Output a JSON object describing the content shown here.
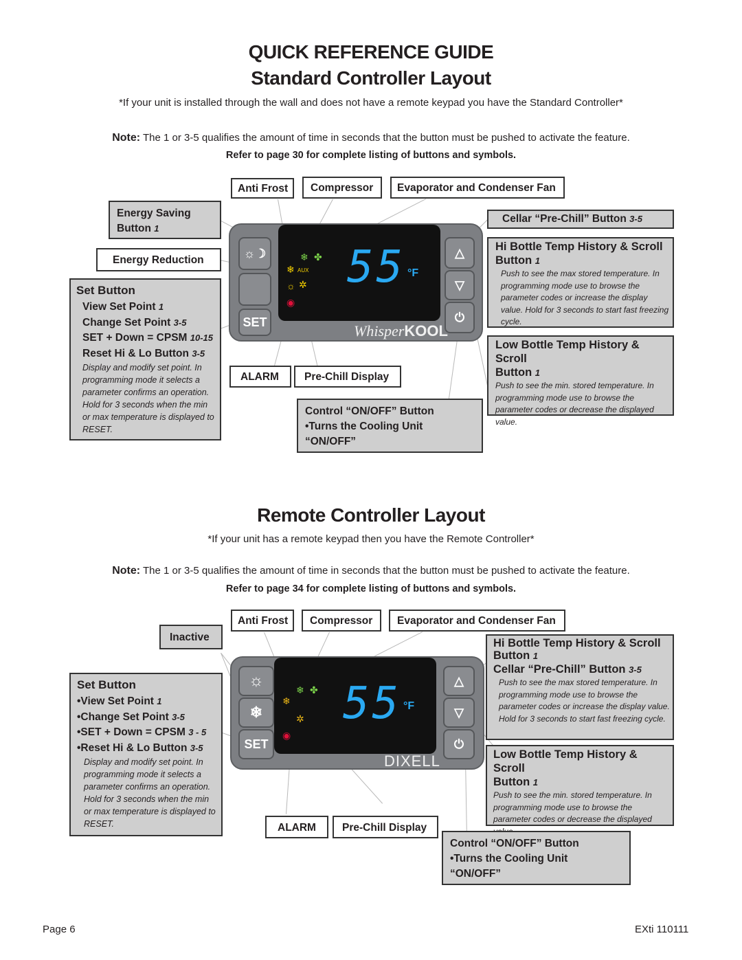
{
  "header": {
    "title": "QUICK REFERENCE GUIDE",
    "subtitle": "Standard Controller Layout"
  },
  "standard": {
    "intro": "*If your unit is installed through the wall and does not have a remote keypad you have the Standard Controller*",
    "note_label": "Note:",
    "note_text": " The 1 or 3-5 qualifies the amount of time in seconds that the button must be pushed to activate the feature.",
    "refer": "Refer to  page 30 for complete listing of buttons and symbols.",
    "labels": {
      "anti_frost": "Anti Frost",
      "compressor": "Compressor",
      "evap_fan": "Evaporator and Condenser Fan",
      "energy_saving": "Energy Saving",
      "energy_saving_2": "Button",
      "energy_saving_time": "1",
      "energy_reduction": "Energy Reduction",
      "cellar_prechill": "Cellar “Pre-Chill” Button",
      "cellar_prechill_time": "3-5",
      "alarm": "ALARM",
      "prechill_display": "Pre-Chill Display"
    },
    "set_button": {
      "title": "Set Button",
      "items": [
        {
          "label": "View Set Point",
          "time": "1"
        },
        {
          "label": "Change Set Point",
          "time": "3-5"
        },
        {
          "label": "SET + Down = CPSM",
          "time": "10-15"
        },
        {
          "label": "Reset Hi & Lo Button",
          "time": "3-5"
        }
      ],
      "desc": "Display and modify set point. In programming mode it selects a parameter confirms an operation. Hold for 3 seconds when the min or max temperature is displayed to RESET."
    },
    "hi_bottle": {
      "title": "Hi Bottle Temp History & Scroll",
      "title2": "Button",
      "time": "1",
      "desc": "Push to see the max stored temperature. In programming mode use to browse the parameter codes or increase the display value. Hold for 3 seconds to start fast freezing cycle."
    },
    "low_bottle": {
      "title": "Low Bottle Temp History & Scroll",
      "title2": "Button",
      "time": "1",
      "desc": "Push to see the min. stored temperature. In programming mode use to browse the parameter codes or decrease the displayed value."
    },
    "onoff": {
      "line1": "Control “ON/OFF” Button",
      "line2": "•Turns the Cooling Unit",
      "line3": "“ON/OFF”"
    },
    "controller": {
      "display_value": "55",
      "unit": "°F",
      "brand_a": "Whisper",
      "brand_b": "KOOL",
      "set_label": "SET",
      "aux_label": "AUX"
    }
  },
  "remote": {
    "title": "Remote Controller Layout",
    "intro": "*If  your unit has a remote keypad then you have the Remote Controller*",
    "note_label": "Note:",
    "note_text": " The 1 or 3-5 qualifies the amount of time in seconds that the button must be pushed to activate the feature.",
    "refer": "Refer to  page 34 for complete listing of buttons and symbols.",
    "labels": {
      "anti_frost": "Anti Frost",
      "compressor": "Compressor",
      "evap_fan": "Evaporator and Condenser Fan",
      "inactive": "Inactive",
      "alarm": "ALARM",
      "prechill_display": "Pre-Chill Display"
    },
    "set_button": {
      "title": "Set Button",
      "items": [
        {
          "label": "•View Set Point",
          "time": "1"
        },
        {
          "label": "•Change Set Point",
          "time": "3-5"
        },
        {
          "label": "•SET + Down = CPSM",
          "time": "3 - 5"
        },
        {
          "label": "•Reset Hi & Lo Button",
          "time": "3-5"
        }
      ],
      "desc": "Display and modify set point. In programming mode it selects a parameter confirms an operation. Hold for 3 seconds when the min or max temperature is displayed to RESET."
    },
    "hi_bottle": {
      "title": "Hi Bottle Temp History & Scroll",
      "title2": "Button",
      "time": "1",
      "title3": "Cellar “Pre-Chill” Button",
      "time3": "3-5",
      "desc": "Push to see the max stored temperature. In programming mode use to browse the parameter codes or increase the display value. Hold for 3 seconds to start fast freezing cycle."
    },
    "low_bottle": {
      "title": "Low Bottle Temp History & Scroll",
      "title2": "Button",
      "time": "1",
      "desc": "Push to see the min. stored temperature. In programming mode use to browse the parameter codes or decrease the displayed value."
    },
    "onoff": {
      "line1": "Control “ON/OFF” Button",
      "line2": "•Turns the Cooling Unit",
      "line3": "“ON/OFF”"
    },
    "controller": {
      "display_value": "55",
      "unit": "°F",
      "brand": "DIXELL",
      "set_label": "SET"
    }
  },
  "footer": {
    "page": "Page 6",
    "doc_id": "EXti 110111"
  }
}
